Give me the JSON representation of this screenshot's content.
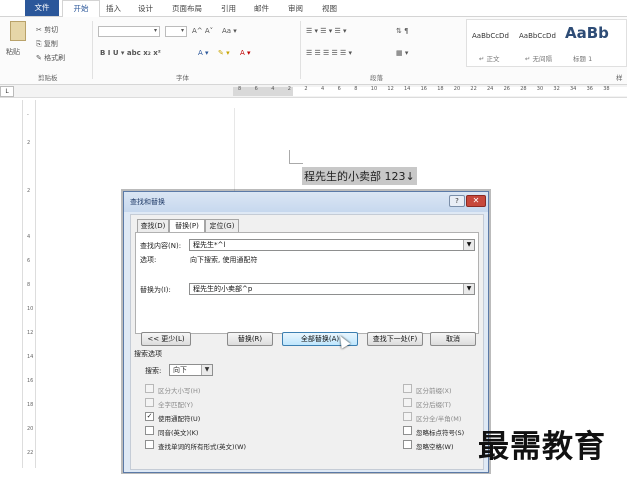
{
  "menu_tabs": [
    "文件",
    "开始",
    "插入",
    "设计",
    "页面布局",
    "引用",
    "邮件",
    "审阅",
    "视图"
  ],
  "ribbon": {
    "clipboard": {
      "paste": "粘贴",
      "cut": "剪切",
      "copy": "复制",
      "format_painter": "格式刷",
      "label": "剪贴板"
    },
    "font": {
      "label": "字体",
      "row2": "B  I  U ▾ abc  x₂  x²",
      "grow": "A^ A˅",
      "case": "Aa ▾"
    },
    "paragraph": {
      "label": "段落"
    },
    "styles": {
      "sample1": "AaBbCcDd",
      "name1": "↵ 正文",
      "sample2": "AaBbCcDd",
      "name2": "↵ 无间隔",
      "sample3": "AaBb",
      "name3": "标题 1",
      "label": "样"
    }
  },
  "ruler": {
    "corner": "L",
    "ticks": [
      "8",
      "6",
      "4",
      "2",
      "2",
      "4",
      "6",
      "8",
      "10",
      "12",
      "14",
      "16",
      "18",
      "20",
      "22",
      "24",
      "26",
      "28",
      "30",
      "32",
      "34",
      "36",
      "38"
    ]
  },
  "document": {
    "text": "程先生的小卖部 123↓"
  },
  "dialog": {
    "title": "查找和替换",
    "help_label": "?",
    "close_label": "✕",
    "tabs": [
      "查找(D)",
      "替换(P)",
      "定位(G)"
    ],
    "find_label": "查找内容(N):",
    "find_value": "程先生*^l",
    "options_label": "选项:",
    "options_value": "向下搜索, 使用通配符",
    "replace_label": "替换为(I):",
    "replace_value": "程先生的小卖部^p",
    "buttons": {
      "less": "<< 更少(L)",
      "replace": "替换(R)",
      "replace_all": "全部替换(A)",
      "find_next": "查找下一处(F)",
      "cancel": "取消"
    },
    "search_options_title": "搜索选项",
    "search_label": "搜索:",
    "search_value": "向下",
    "left_options": [
      {
        "label": "区分大小写(H)",
        "checked": false,
        "disabled": true
      },
      {
        "label": "全字匹配(Y)",
        "checked": false,
        "disabled": true
      },
      {
        "label": "使用通配符(U)",
        "checked": true,
        "disabled": false
      },
      {
        "label": "同音(英文)(K)",
        "checked": false,
        "disabled": false
      },
      {
        "label": "查找单词的所有形式(英文)(W)",
        "checked": false,
        "disabled": false
      }
    ],
    "right_options": [
      {
        "label": "区分前缀(X)",
        "checked": false,
        "disabled": true
      },
      {
        "label": "区分后缀(T)",
        "checked": false,
        "disabled": true
      },
      {
        "label": "区分全/半角(M)",
        "checked": false,
        "disabled": true
      },
      {
        "label": "忽略标点符号(S)",
        "checked": false,
        "disabled": false
      },
      {
        "label": "忽略空格(W)",
        "checked": false,
        "disabled": false
      }
    ]
  },
  "watermark": "最需教育",
  "colors": {
    "file_tab": "#2b579a",
    "close_button": "#c7483b"
  }
}
